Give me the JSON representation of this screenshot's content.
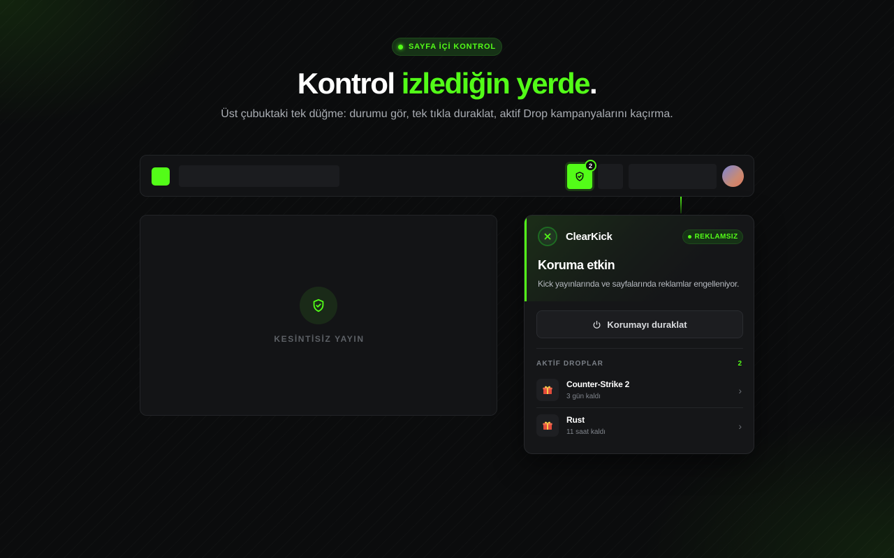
{
  "hero": {
    "pill": "SAYFA İÇİ KONTROL",
    "headline_main": "Kontrol ",
    "headline_accent": "izlediğin yerde",
    "headline_end": ".",
    "subtitle": "Üst çubuktaki tek düğme: durumu gör, tek tıkla duraklat, aktif Drop kampanyalarını kaçırma."
  },
  "topbar": {
    "extension_badge": "2"
  },
  "player": {
    "label": "KESİNTİSİZ YAYIN"
  },
  "popup": {
    "brand": "ClearKick",
    "adfree_badge": "REKLAMSIZ",
    "status_title": "Koruma etkin",
    "status_desc": "Kick yayınlarında ve sayfalarında reklamlar engelleniyor.",
    "pause_button": "Korumayı duraklat",
    "drops_heading": "AKTİF DROPLAR",
    "drops_count": "2",
    "drops": [
      {
        "name": "Counter-Strike 2",
        "time": "3 gün kaldı"
      },
      {
        "name": "Rust",
        "time": "11 saat kaldı"
      }
    ]
  },
  "colors": {
    "accent": "#53fc18",
    "background": "#0b0c0d",
    "panel": "#151618"
  },
  "icons": {
    "extension": "shield-check-icon",
    "player": "shield-check-icon",
    "pause": "power-icon",
    "drop": "gift-icon",
    "chevron": "chevron-right-icon"
  }
}
